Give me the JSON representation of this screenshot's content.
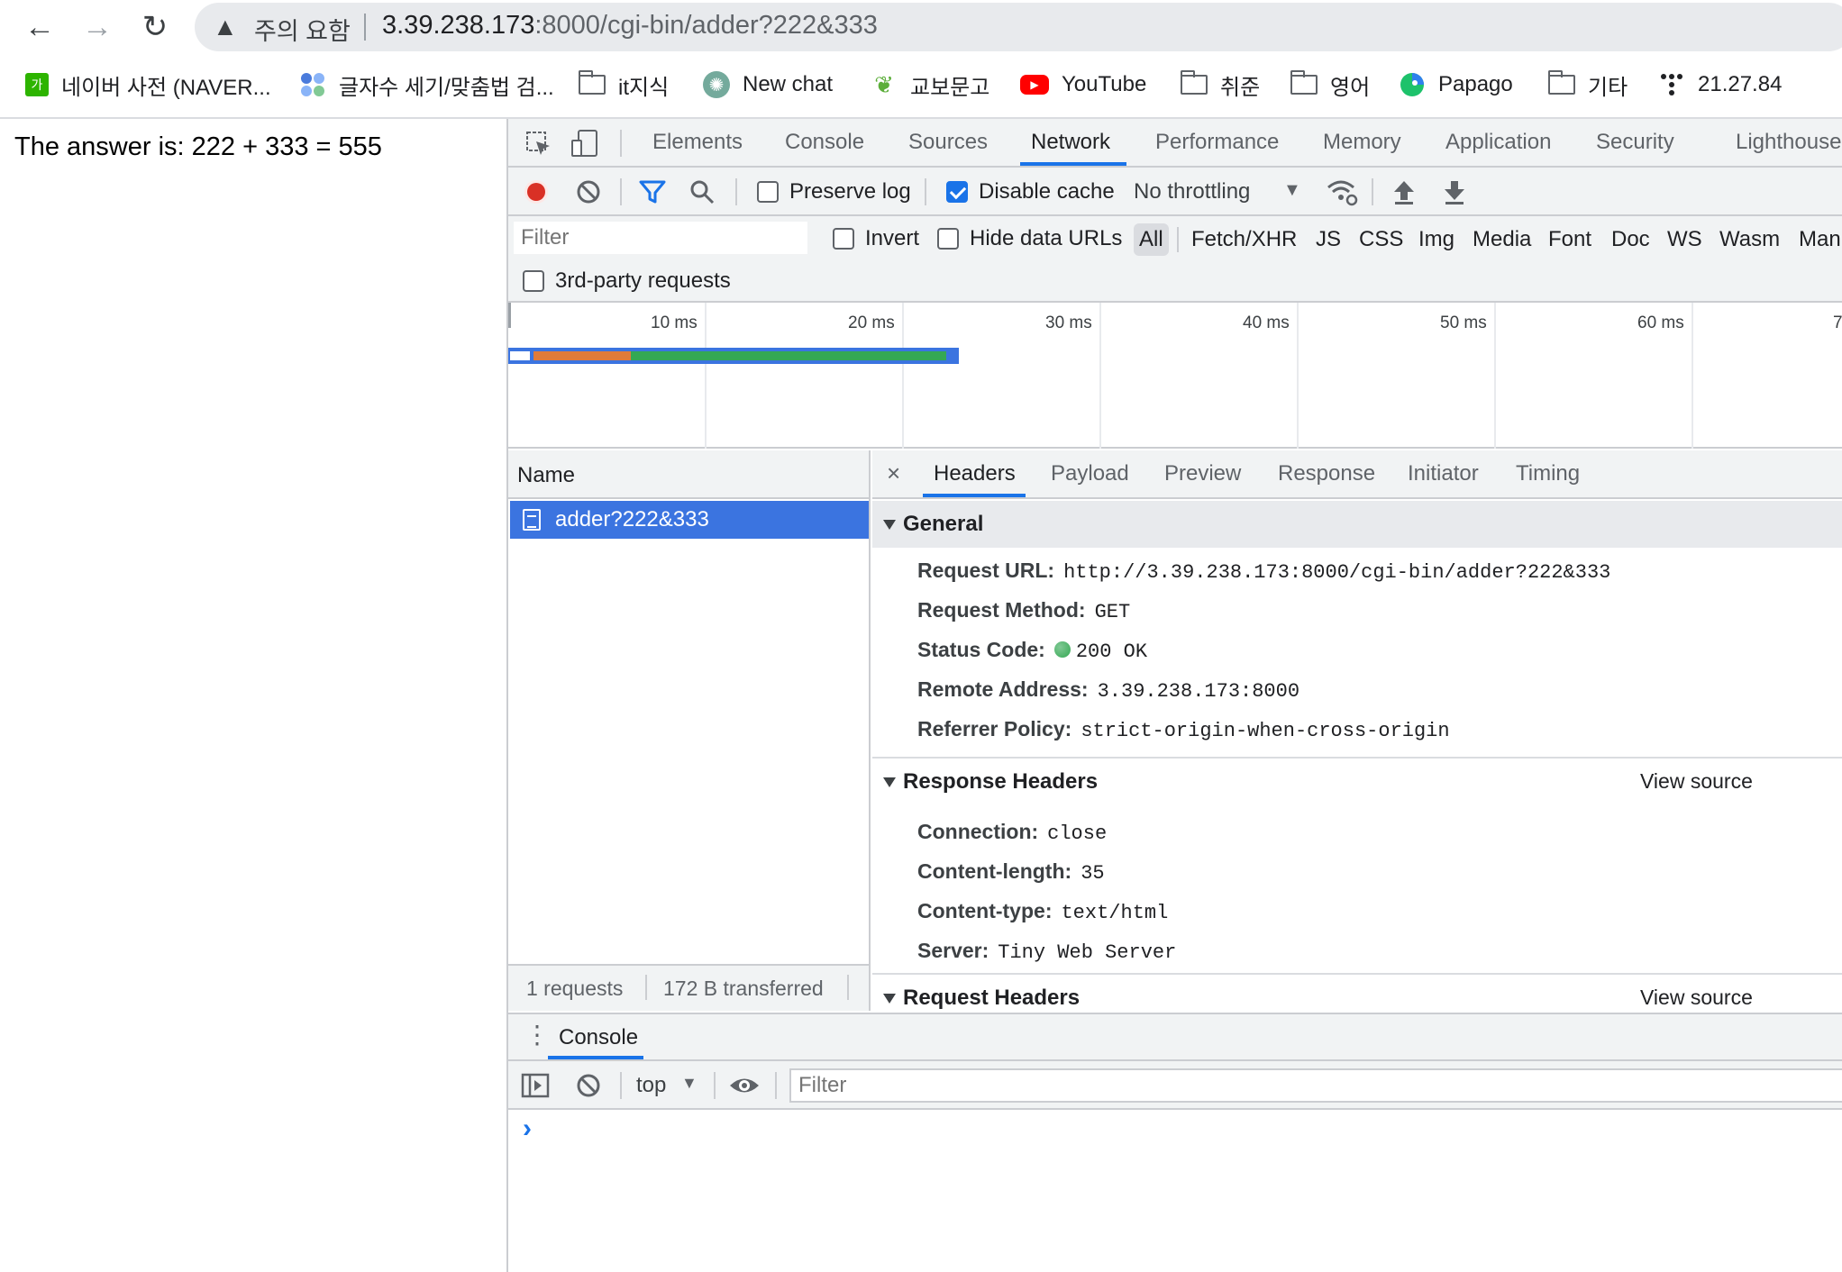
{
  "browser": {
    "security_label": "주의 요함",
    "url_host": "3.39.238.173",
    "url_rest": ":8000/cgi-bin/adder?222&333",
    "bookmarks": [
      {
        "label": "네이버 사전 (NAVER...",
        "icon": "naver-dict-icon"
      },
      {
        "label": "글자수 세기/맞춤법 검...",
        "icon": "dots-icon"
      },
      {
        "label": "it지식",
        "icon": "folder-icon"
      },
      {
        "label": "New chat",
        "icon": "chatgpt-icon"
      },
      {
        "label": "교보문고",
        "icon": "kyobo-icon"
      },
      {
        "label": "YouTube",
        "icon": "youtube-icon"
      },
      {
        "label": "취준",
        "icon": "folder-icon"
      },
      {
        "label": "영어",
        "icon": "folder-icon"
      },
      {
        "label": "Papago",
        "icon": "papago-icon"
      },
      {
        "label": "기타",
        "icon": "folder-icon"
      },
      {
        "label": "21.27.84",
        "icon": "dots-grid-icon"
      }
    ]
  },
  "page": {
    "answer": "The answer is: 222 + 333 = 555"
  },
  "devtools": {
    "tabs": [
      "Elements",
      "Console",
      "Sources",
      "Network",
      "Performance",
      "Memory",
      "Application",
      "Security",
      "Lighthouse"
    ],
    "active_tab": "Network",
    "toolbar": {
      "preserve_log": "Preserve log",
      "disable_cache": "Disable cache",
      "throttling": "No throttling"
    },
    "filter": {
      "placeholder": "Filter",
      "invert": "Invert",
      "hide_data_urls": "Hide data URLs",
      "types": [
        "All",
        "Fetch/XHR",
        "JS",
        "CSS",
        "Img",
        "Media",
        "Font",
        "Doc",
        "WS",
        "Wasm",
        "Man"
      ],
      "third_party": "3rd-party requests"
    },
    "timeline": {
      "ticks": [
        "10 ms",
        "20 ms",
        "30 ms",
        "40 ms",
        "50 ms",
        "60 ms",
        "7"
      ]
    },
    "requests": {
      "column": "Name",
      "rows": [
        "adder?222&333"
      ],
      "count": "1 requests",
      "transferred": "172 B transferred"
    },
    "detail": {
      "tabs": [
        "Headers",
        "Payload",
        "Preview",
        "Response",
        "Initiator",
        "Timing"
      ],
      "active_tab": "Headers",
      "general": {
        "title": "General",
        "rows": [
          {
            "k": "Request URL:",
            "v": "http://3.39.238.173:8000/cgi-bin/adder?222&333"
          },
          {
            "k": "Request Method:",
            "v": "GET"
          },
          {
            "k": "Status Code:",
            "v": "200 OK"
          },
          {
            "k": "Remote Address:",
            "v": "3.39.238.173:8000"
          },
          {
            "k": "Referrer Policy:",
            "v": "strict-origin-when-cross-origin"
          }
        ]
      },
      "response_headers": {
        "title": "Response Headers",
        "view_source": "View source",
        "rows": [
          {
            "k": "Connection:",
            "v": "close"
          },
          {
            "k": "Content-length:",
            "v": "35"
          },
          {
            "k": "Content-type:",
            "v": "text/html"
          },
          {
            "k": "Server:",
            "v": "Tiny Web Server"
          }
        ]
      },
      "request_headers": {
        "title": "Request Headers",
        "view_source": "View source"
      }
    },
    "console": {
      "tab": "Console",
      "context": "top",
      "filter_placeholder": "Filter",
      "prompt": "›"
    },
    "colors": {
      "accent": "#1a73e8",
      "selected_row": "#3b74e0",
      "record": "#d93025",
      "status_ok": "#34a853",
      "waterfall_wait": "#e07b39",
      "waterfall_download": "#34a853"
    }
  }
}
